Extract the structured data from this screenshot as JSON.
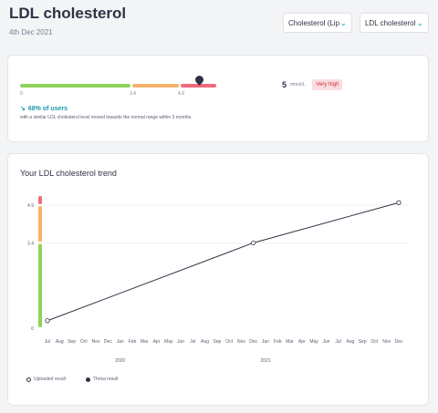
{
  "header": {
    "title": "LDL cholesterol",
    "date": "4th Dec 2021"
  },
  "dropdowns": [
    {
      "selected": "Cholesterol (Lip"
    },
    {
      "selected": "LDL cholesterol"
    }
  ],
  "range": {
    "ticks": [
      "0",
      "3.4",
      "4.9"
    ],
    "segments": [
      {
        "name": "normal",
        "color": "#8fd35a"
      },
      {
        "name": "borderline",
        "color": "#f6b26b"
      },
      {
        "name": "high",
        "color": "#f06a7a"
      }
    ],
    "value": "5",
    "unit": "mmol/L",
    "status": "Very high",
    "marker_value": 5
  },
  "users": {
    "percent": "68% of users",
    "description": "with a similar LDL cholesterol level moved towards the normal range within 3 months."
  },
  "trend": {
    "title": "Your LDL cholesterol trend"
  },
  "chart_data": {
    "type": "line",
    "y_ticks": [
      "0",
      "3.4",
      "4.9"
    ],
    "x_month_labels": [
      "Jul",
      "Aug",
      "Sep",
      "Oct",
      "Nov",
      "Dec",
      "Jan",
      "Feb",
      "Mar",
      "Apr",
      "May",
      "Jun",
      "Jul",
      "Aug",
      "Sep",
      "Oct",
      "Nov",
      "Dec",
      "Jan",
      "Feb",
      "Mar",
      "Apr",
      "May",
      "Jun",
      "Jul",
      "Aug",
      "Sep",
      "Oct",
      "Nov",
      "Dec"
    ],
    "x_year_labels": [
      "2020",
      "2021"
    ],
    "series": [
      {
        "points": [
          {
            "x": "Jul 2019",
            "y": 0.3
          },
          {
            "x": "Dec 2020",
            "y": 3.4
          },
          {
            "x": "Dec 2021",
            "y": 5.0
          }
        ]
      }
    ],
    "ylim": [
      0,
      5.3
    ],
    "grid": true,
    "colors": {
      "low": "#8fd35a",
      "mid": "#f6b26b",
      "high": "#f06a7a",
      "line": "#2f3245"
    }
  },
  "legend": {
    "uploaded": "Uploaded result",
    "thriva": "Thriva result"
  }
}
